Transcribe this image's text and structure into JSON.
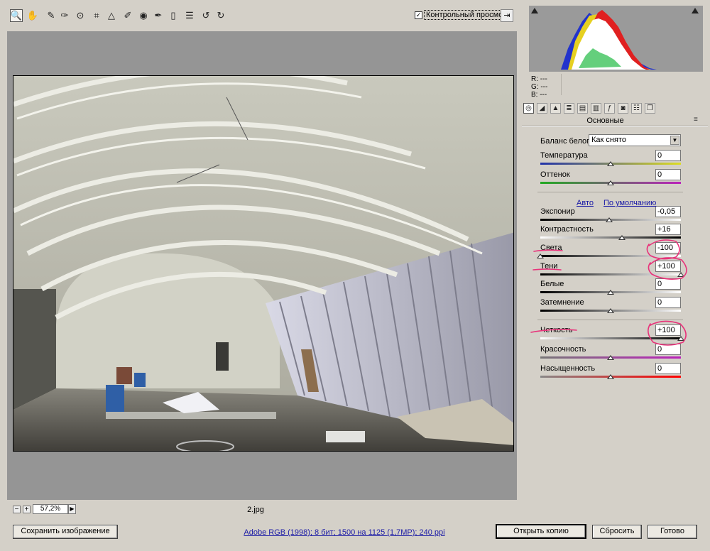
{
  "toolbar": {
    "tools": [
      "zoom-icon",
      "hand-icon",
      "white-balance-icon",
      "color-sampler-icon",
      "target-adjust-icon",
      "crop-icon",
      "straighten-icon",
      "spot-removal-icon",
      "red-eye-icon",
      "adjustment-brush-icon",
      "graduated-filter-icon",
      "preferences-icon",
      "rotate-left-icon",
      "rotate-right-icon"
    ],
    "preview_checked": "✓",
    "preview_label": "Контрольный просмотр",
    "fullscreen_symbol": "⇥"
  },
  "canvas": {
    "zoom_minus": "−",
    "zoom_plus": "+",
    "zoom_value": "57,2%",
    "zoom_arrow": "▶",
    "filename": "2.jpg"
  },
  "rgb_readout": {
    "r": "R:  ---",
    "g": "G:  ---",
    "b": "B:  ---"
  },
  "panel": {
    "title": "Основные",
    "menu_symbol": "≡",
    "white_balance": {
      "label": "Баланс белого:",
      "value": "Как снято",
      "arrow": "▼"
    },
    "auto_link": "Авто",
    "default_link": "По умолчанию",
    "sliders": [
      {
        "label": "Температура",
        "value": "0",
        "position": 0.5,
        "colors": [
          "#2233aa",
          "#dddd22"
        ]
      },
      {
        "label": "Оттенок",
        "value": "0",
        "position": 0.5,
        "colors": [
          "#22aa22",
          "#bb22bb"
        ]
      },
      {
        "label": "Экспонир",
        "value": "-0,05",
        "position": 0.49,
        "colors": [
          "#000000",
          "#ffffff"
        ]
      },
      {
        "label": "Контрастность",
        "value": "+16",
        "position": 0.58,
        "colors": [
          "#ffffff",
          "#000000"
        ]
      },
      {
        "label": "Света",
        "value": "-100",
        "position": 0.0,
        "colors": [
          "#000000",
          "#ffffff"
        ]
      },
      {
        "label": "Тени",
        "value": "+100",
        "position": 1.0,
        "colors": [
          "#000000",
          "#ffffff"
        ]
      },
      {
        "label": "Белые",
        "value": "0",
        "position": 0.5,
        "colors": [
          "#000000",
          "#ffffff"
        ]
      },
      {
        "label": "Затемнение",
        "value": "0",
        "position": 0.5,
        "colors": [
          "#000000",
          "#ffffff"
        ]
      },
      {
        "label": "Четкость",
        "value": "+100",
        "position": 1.0,
        "colors": [
          "#ffffff",
          "#000000"
        ]
      },
      {
        "label": "Красочность",
        "value": "0",
        "position": 0.5,
        "colors": [
          "#777777",
          "#bb22bb"
        ]
      },
      {
        "label": "Насыщенность",
        "value": "0",
        "position": 0.5,
        "colors": [
          "#888888",
          "#ff0000"
        ]
      }
    ]
  },
  "bottom": {
    "save_label": "Сохранить изображение",
    "workflow_link": "Adobe RGB (1998); 8 бит; 1500 на 1125 (1,7MP); 240 ppi",
    "open_label": "Открыть копию",
    "reset_label": "Сбросить",
    "done_label": "Готово"
  },
  "colors": {
    "link": "#1a1aa6",
    "annotation": "#e8337a",
    "canvas_bg": "#959595"
  }
}
